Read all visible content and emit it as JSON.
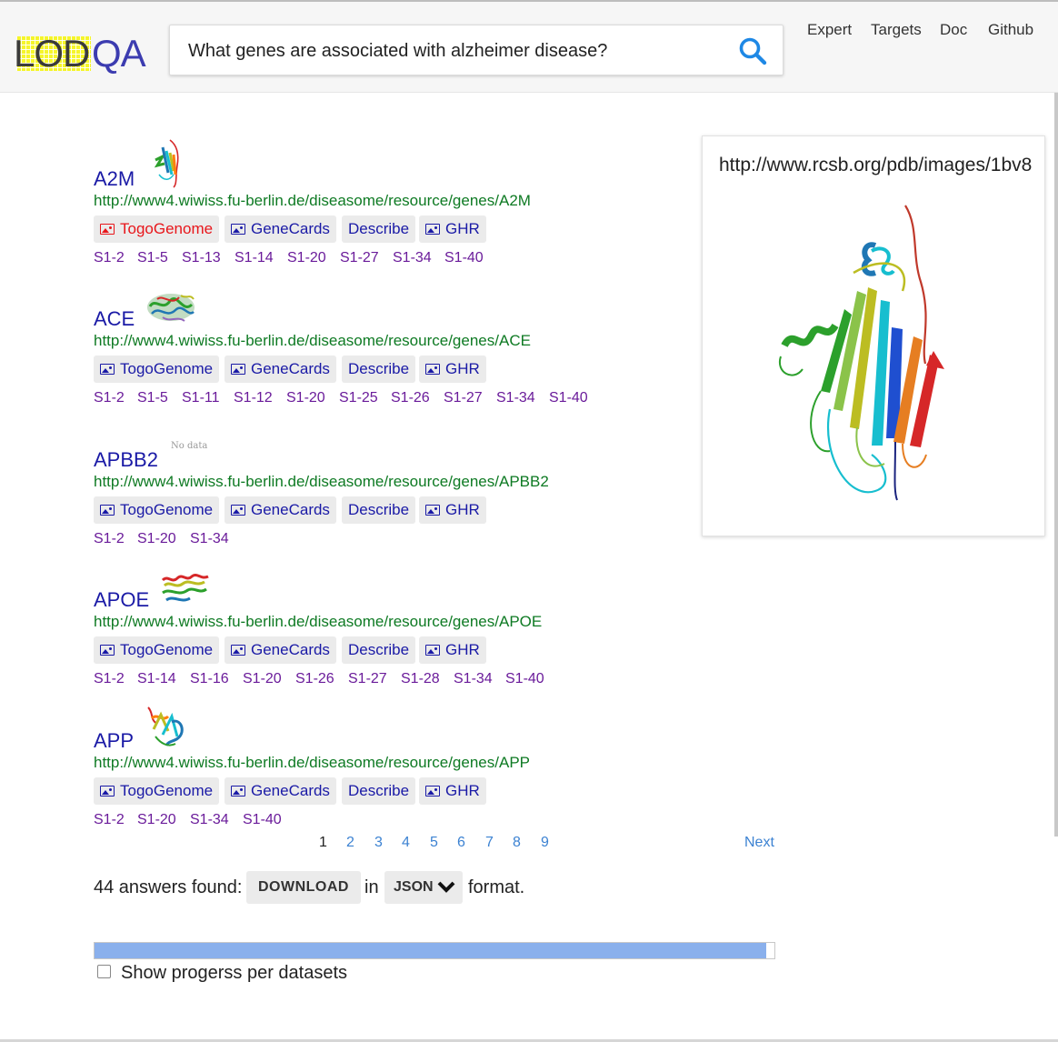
{
  "header": {
    "logo_left": "LOD",
    "logo_right": "QA",
    "search_value": "What genes are associated with alzheimer disease?",
    "search_icon": "search-icon",
    "nav": [
      "Expert",
      "Targets",
      "Doc",
      "Github"
    ]
  },
  "answers": [
    {
      "name": "A2M",
      "url": "http://www4.wiwiss.fu-berlin.de/diseasome/resource/genes/A2M",
      "buttons": {
        "togogenome": "TogoGenome",
        "genecards": "GeneCards",
        "describe": "Describe",
        "ghr": "GHR"
      },
      "datasets": [
        "S1-2",
        "S1-5",
        "S1-13",
        "S1-14",
        "S1-20",
        "S1-27",
        "S1-34",
        "S1-40"
      ]
    },
    {
      "name": "ACE",
      "url": "http://www4.wiwiss.fu-berlin.de/diseasome/resource/genes/ACE",
      "buttons": {
        "togogenome": "TogoGenome",
        "genecards": "GeneCards",
        "describe": "Describe",
        "ghr": "GHR"
      },
      "datasets": [
        "S1-2",
        "S1-5",
        "S1-11",
        "S1-12",
        "S1-20",
        "S1-25",
        "S1-26",
        "S1-27",
        "S1-34",
        "S1-40"
      ]
    },
    {
      "name": "APBB2",
      "thumb_text": "No data",
      "url": "http://www4.wiwiss.fu-berlin.de/diseasome/resource/genes/APBB2",
      "buttons": {
        "togogenome": "TogoGenome",
        "genecards": "GeneCards",
        "describe": "Describe",
        "ghr": "GHR"
      },
      "datasets": [
        "S1-2",
        "S1-20",
        "S1-34"
      ]
    },
    {
      "name": "APOE",
      "url": "http://www4.wiwiss.fu-berlin.de/diseasome/resource/genes/APOE",
      "buttons": {
        "togogenome": "TogoGenome",
        "genecards": "GeneCards",
        "describe": "Describe",
        "ghr": "GHR"
      },
      "datasets": [
        "S1-2",
        "S1-14",
        "S1-16",
        "S1-20",
        "S1-26",
        "S1-27",
        "S1-28",
        "S1-34",
        "S1-40"
      ]
    },
    {
      "name": "APP",
      "url": "http://www4.wiwiss.fu-berlin.de/diseasome/resource/genes/APP",
      "buttons": {
        "togogenome": "TogoGenome",
        "genecards": "GeneCards",
        "describe": "Describe",
        "ghr": "GHR"
      },
      "datasets": [
        "S1-2",
        "S1-20",
        "S1-34",
        "S1-40"
      ]
    }
  ],
  "pagination": {
    "current": "1",
    "pages": [
      "2",
      "3",
      "4",
      "5",
      "6",
      "7",
      "8",
      "9"
    ],
    "next": "Next"
  },
  "summary": {
    "count_text": "44 answers found:",
    "download": "DOWNLOAD",
    "in": "in",
    "format": "JSON",
    "format_suffix": "format."
  },
  "progress": {
    "fraction": 0.988,
    "show_label": "Show progerss per datasets"
  },
  "preview": {
    "url": "http://www.rcsb.org/pdb/images/1bv8"
  },
  "colors": {
    "link": "#1a1aa6",
    "url_green": "#0e7a23",
    "dataset_purple": "#6a1b9a",
    "active_red": "#e8161b",
    "progress_fill": "#8ab0ec"
  }
}
